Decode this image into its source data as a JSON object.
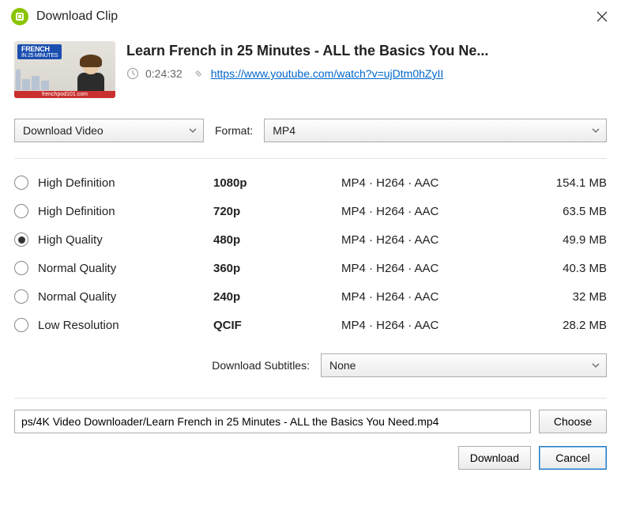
{
  "window": {
    "title": "Download Clip"
  },
  "video": {
    "title": "Learn French in 25 Minutes - ALL the Basics You Ne...",
    "duration": "0:24:32",
    "url": "https://www.youtube.com/watch?v=ujDtm0hZyII",
    "thumb_banner_top": "FRENCH",
    "thumb_banner_sub": "IN 25 MINUTES",
    "thumb_footer": "frenchpod101.com"
  },
  "action_select": "Download Video",
  "format_label": "Format:",
  "format_select": "MP4",
  "qualities": [
    {
      "label": "High Definition",
      "res": "1080p",
      "codec": "MP4 · H264 · AAC",
      "size": "154.1 MB",
      "selected": false
    },
    {
      "label": "High Definition",
      "res": "720p",
      "codec": "MP4 · H264 · AAC",
      "size": "63.5 MB",
      "selected": false
    },
    {
      "label": "High Quality",
      "res": "480p",
      "codec": "MP4 · H264 · AAC",
      "size": "49.9 MB",
      "selected": true
    },
    {
      "label": "Normal Quality",
      "res": "360p",
      "codec": "MP4 · H264 · AAC",
      "size": "40.3 MB",
      "selected": false
    },
    {
      "label": "Normal Quality",
      "res": "240p",
      "codec": "MP4 · H264 · AAC",
      "size": "32 MB",
      "selected": false
    },
    {
      "label": "Low Resolution",
      "res": "QCIF",
      "codec": "MP4 · H264 · AAC",
      "size": "28.2 MB",
      "selected": false
    }
  ],
  "subtitles_label": "Download Subtitles:",
  "subtitles_select": "None",
  "save_path": "ps/4K Video Downloader/Learn French in 25 Minutes - ALL the Basics You Need.mp4",
  "buttons": {
    "choose": "Choose",
    "download": "Download",
    "cancel": "Cancel"
  }
}
